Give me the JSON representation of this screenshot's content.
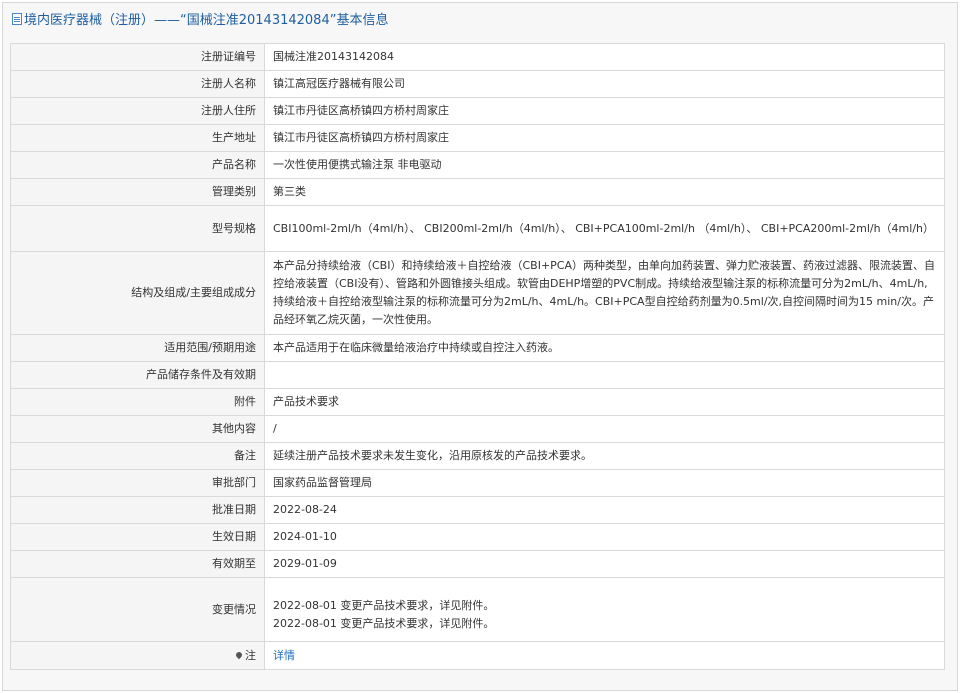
{
  "header": {
    "title": "境内医疗器械（注册）——“国械注准20143142084”基本信息"
  },
  "rows": [
    {
      "label": "注册证编号",
      "value": "国械注准20143142084"
    },
    {
      "label": "注册人名称",
      "value": "镇江高冠医疗器械有限公司"
    },
    {
      "label": "注册人住所",
      "value": "镇江市丹徒区高桥镇四方桥村周家庄"
    },
    {
      "label": "生产地址",
      "value": "镇江市丹徒区高桥镇四方桥村周家庄"
    },
    {
      "label": "产品名称",
      "value": "一次性使用便携式输注泵 非电驱动"
    },
    {
      "label": "管理类别",
      "value": "第三类"
    },
    {
      "label": "型号规格",
      "value": "CBI100ml-2ml/h（4ml/h）、 CBI200ml-2ml/h（4ml/h）、 CBI+PCA100ml-2ml/h （4ml/h）、 CBI+PCA200ml-2ml/h（4ml/h）"
    },
    {
      "label": "结构及组成/主要组成成分",
      "value": "本产品分持续给液（CBI）和持续给液＋自控给液（CBI+PCA）两种类型，由单向加药装置、弹力贮液装置、药液过滤器、限流装置、自控给液装置（CBI没有）、管路和外圆锥接头组成。软管由DEHP增塑的PVC制成。持续给液型输注泵的标称流量可分为2mL/h、4mL/h,持续给液＋自控给液型输注泵的标称流量可分为2mL/h、4mL/h。CBI+PCA型自控给药剂量为0.5ml/次,自控间隔时间为15 min/次。产品经环氧乙烷灭菌，一次性使用。"
    },
    {
      "label": "适用范围/预期用途",
      "value": "本产品适用于在临床微量给液治疗中持续或自控注入药液。"
    },
    {
      "label": "产品储存条件及有效期",
      "value": ""
    },
    {
      "label": "附件",
      "value": "产品技术要求"
    },
    {
      "label": "其他内容",
      "value": "/"
    },
    {
      "label": "备注",
      "value": "延续注册产品技术要求未发生变化，沿用原核发的产品技术要求。"
    },
    {
      "label": "审批部门",
      "value": "国家药品监督管理局"
    },
    {
      "label": "批准日期",
      "value": "2022-08-24"
    },
    {
      "label": "生效日期",
      "value": "2024-01-10"
    },
    {
      "label": "有效期至",
      "value": "2029-01-09"
    }
  ],
  "change": {
    "label": "变更情况",
    "lines": [
      "2022-08-01 变更产品技术要求，详见附件。",
      "2022-08-01 变更产品技术要求，详见附件。"
    ]
  },
  "note": {
    "label": "注",
    "icon": "pin-icon",
    "link": "详情"
  }
}
